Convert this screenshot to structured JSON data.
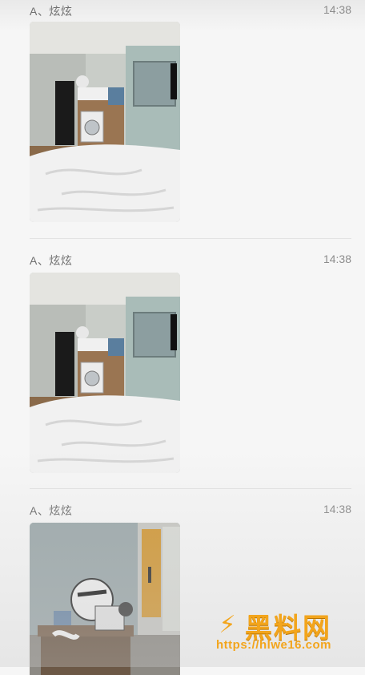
{
  "messages": [
    {
      "sender": "A、炫炫",
      "time": "14:38",
      "image": "bedroom-laundry-photo"
    },
    {
      "sender": "A、炫炫",
      "time": "14:38",
      "image": "bedroom-laundry-photo"
    },
    {
      "sender": "A、炫炫",
      "time": "14:38",
      "image": "room-desk-helmet-photo"
    }
  ],
  "watermark": {
    "logo_glyph": "⚡",
    "title": "黑料网",
    "url": "https://hlwe16.com"
  },
  "colors": {
    "watermark": "#f3a51c",
    "sender_text": "#6f6f6f",
    "time_text": "#8c8c8c"
  }
}
